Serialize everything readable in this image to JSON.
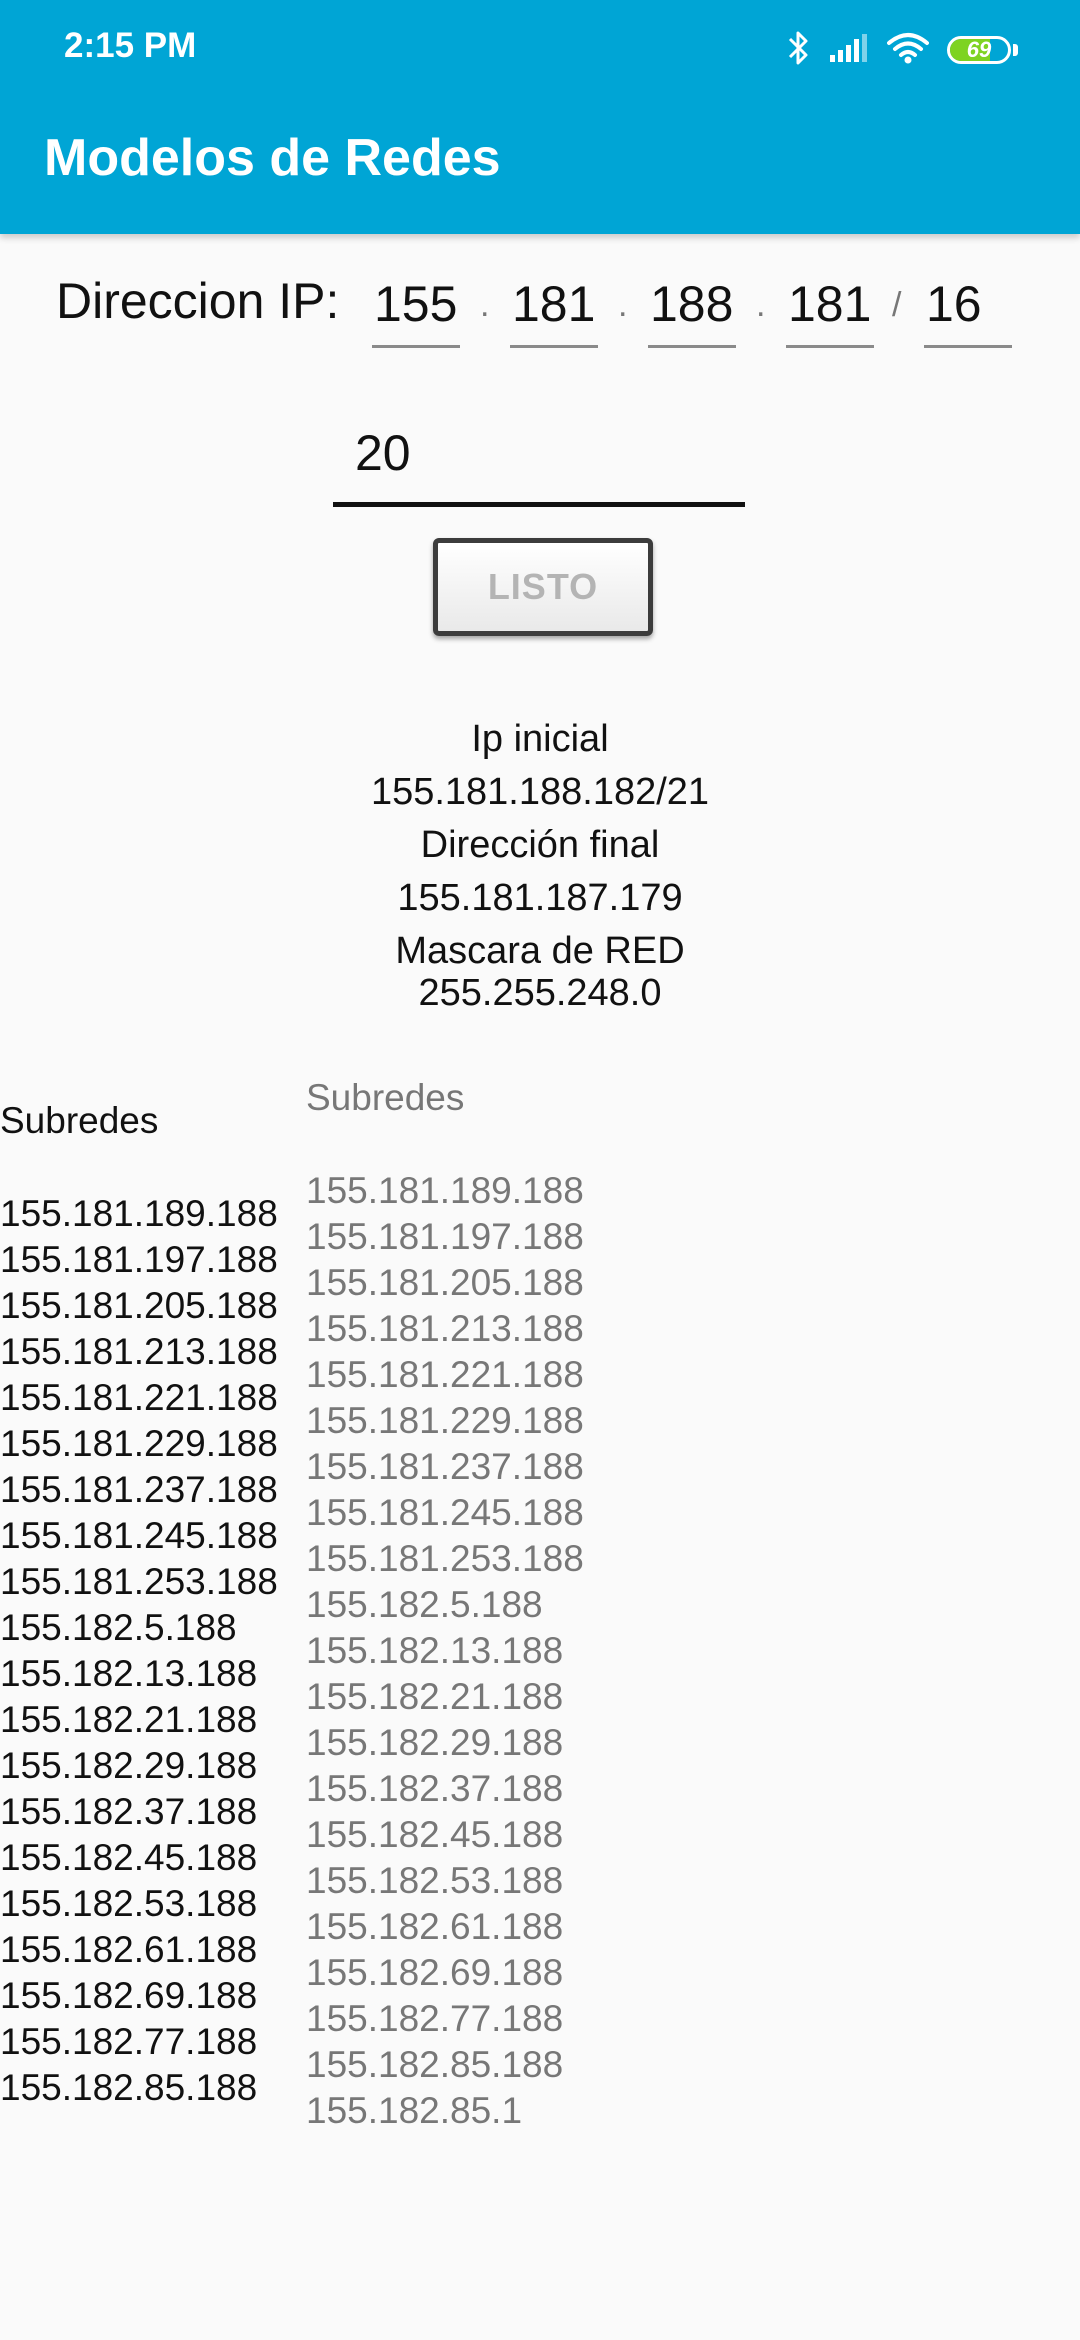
{
  "status_bar": {
    "time": "2:15 PM",
    "battery": "69",
    "battery_level": 0.69,
    "icons": [
      "bluetooth-icon",
      "signal-icon",
      "wifi-icon",
      "battery-icon"
    ]
  },
  "app_bar": {
    "title": "Modelos de Redes",
    "color": "#00a5d5"
  },
  "ip_form": {
    "label": "Direccion IP:",
    "octets": [
      "155",
      "181",
      "188",
      "181"
    ],
    "dot": ".",
    "slash": "/",
    "prefix": "16",
    "mask_input": "20",
    "button_label": "LISTO"
  },
  "results": {
    "ip_inicial_label": "Ip inicial",
    "ip_inicial": "155.181.188.182/21",
    "direccion_final_label": "Dirección final",
    "direccion_final": "155.181.187.179",
    "mascara_label": "Mascara de RED",
    "mascara": "255.255.248.0"
  },
  "subnets_left": {
    "title": "Subredes",
    "items": [
      "155.181.189.188",
      "155.181.197.188",
      "155.181.205.188",
      "155.181.213.188",
      "155.181.221.188",
      "155.181.229.188",
      "155.181.237.188",
      "155.181.245.188",
      "155.181.253.188",
      "155.182.5.188",
      "155.182.13.188",
      "155.182.21.188",
      "155.182.29.188",
      "155.182.37.188",
      "155.182.45.188",
      "155.182.53.188",
      "155.182.61.188",
      "155.182.69.188",
      "155.182.77.188",
      "155.182.85.188"
    ]
  },
  "subnets_right": {
    "title": "Subredes",
    "items": [
      "155.181.189.188",
      "155.181.197.188",
      "155.181.205.188",
      "155.181.213.188",
      "155.181.221.188",
      "155.181.229.188",
      "155.181.237.188",
      "155.181.245.188",
      "155.181.253.188",
      "155.182.5.188",
      "155.182.13.188",
      "155.182.21.188",
      "155.182.29.188",
      "155.182.37.188",
      "155.182.45.188",
      "155.182.53.188",
      "155.182.61.188",
      "155.182.69.188",
      "155.182.77.188",
      "155.182.85.188",
      "155.182.85.1"
    ]
  }
}
